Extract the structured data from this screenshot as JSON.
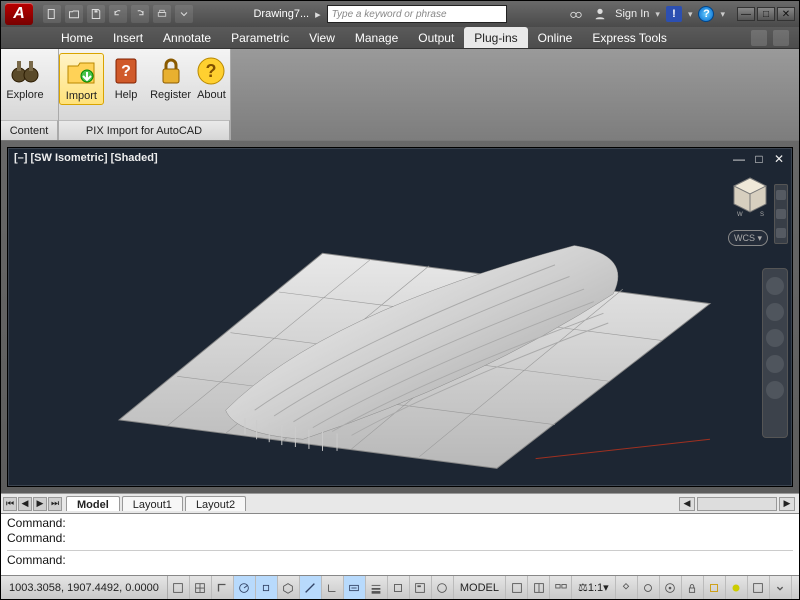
{
  "title": {
    "document": "Drawing7...",
    "search_placeholder": "Type a keyword or phrase",
    "signin": "Sign In"
  },
  "ribbon_tabs": [
    "Home",
    "Insert",
    "Annotate",
    "Parametric",
    "View",
    "Manage",
    "Output",
    "Plug-ins",
    "Online",
    "Express Tools"
  ],
  "active_tab": "Plug-ins",
  "ribbon": {
    "group1": {
      "label": "Content",
      "explore": "Explore"
    },
    "group2": {
      "label": "PIX Import for AutoCAD",
      "import": "Import",
      "help": "Help",
      "register": "Register",
      "about": "About"
    }
  },
  "viewport": {
    "label": "[–] [SW Isometric] [Shaded]",
    "wcs": "WCS ▾"
  },
  "layout": {
    "tabs": [
      "Model",
      "Layout1",
      "Layout2"
    ],
    "active": "Model"
  },
  "command": {
    "l1": "Command:",
    "l2": "Command:",
    "prompt": "Command:"
  },
  "status": {
    "coords": "1003.3058, 1907.4492, 0.0000",
    "model": "MODEL",
    "scale": "1:1"
  }
}
